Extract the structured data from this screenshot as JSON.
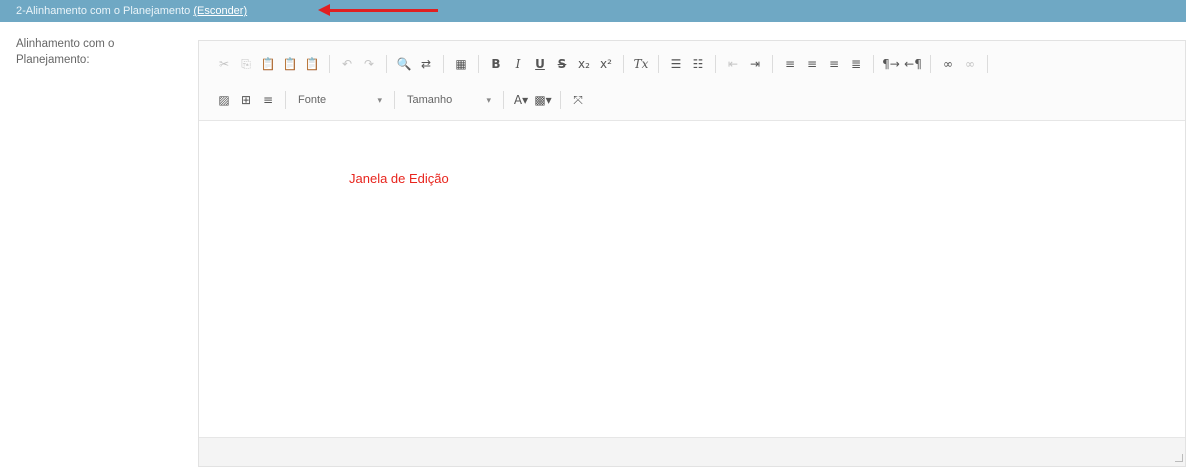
{
  "section": {
    "title": "2-Alinhamento com o Planejamento",
    "hide_link": "(Esconder)"
  },
  "field": {
    "label_line1": "Alinhamento com o",
    "label_line2": "Planejamento:"
  },
  "toolbar": {
    "row1": [
      {
        "name": "cut-icon",
        "glyph": "✂",
        "disabled": true
      },
      {
        "name": "copy-icon",
        "glyph": "⎘",
        "disabled": true
      },
      {
        "name": "paste-icon",
        "glyph": "📋",
        "disabled": false
      },
      {
        "name": "paste-text-icon",
        "glyph": "📋",
        "disabled": false
      },
      {
        "name": "paste-word-icon",
        "glyph": "📋",
        "disabled": false
      },
      {
        "sep": true
      },
      {
        "name": "undo-icon",
        "glyph": "↶",
        "disabled": true
      },
      {
        "name": "redo-icon",
        "glyph": "↷",
        "disabled": true
      },
      {
        "sep": true
      },
      {
        "name": "find-icon",
        "glyph": "🔍",
        "disabled": false
      },
      {
        "name": "replace-icon",
        "glyph": "⇄",
        "disabled": false
      },
      {
        "sep": true
      },
      {
        "name": "select-all-icon",
        "glyph": "▦",
        "disabled": false
      },
      {
        "sep": true
      },
      {
        "name": "bold-icon",
        "glyph": "B",
        "style": "bold"
      },
      {
        "name": "italic-icon",
        "glyph": "I",
        "style": "ital"
      },
      {
        "name": "underline-icon",
        "glyph": "U",
        "style": "und"
      },
      {
        "name": "strikethrough-icon",
        "glyph": "S",
        "style": "strk"
      },
      {
        "name": "subscript-icon",
        "glyph": "x₂"
      },
      {
        "name": "superscript-icon",
        "glyph": "x²"
      },
      {
        "sep": true
      },
      {
        "name": "remove-format-icon",
        "glyph": "Tx",
        "style": "ital"
      },
      {
        "sep": true
      },
      {
        "name": "numbered-list-icon",
        "glyph": "☰"
      },
      {
        "name": "bulleted-list-icon",
        "glyph": "☷"
      },
      {
        "sep": true
      },
      {
        "name": "outdent-icon",
        "glyph": "⇤",
        "disabled": true
      },
      {
        "name": "indent-icon",
        "glyph": "⇥"
      },
      {
        "sep": true
      },
      {
        "name": "align-left-icon",
        "glyph": "≡"
      },
      {
        "name": "align-center-icon",
        "glyph": "≡"
      },
      {
        "name": "align-right-icon",
        "glyph": "≡"
      },
      {
        "name": "align-justify-icon",
        "glyph": "≣"
      },
      {
        "sep": true
      },
      {
        "name": "ltr-icon",
        "glyph": "¶→"
      },
      {
        "name": "rtl-icon",
        "glyph": "←¶"
      },
      {
        "sep": true
      },
      {
        "name": "link-icon",
        "glyph": "∞"
      },
      {
        "name": "unlink-icon",
        "glyph": "∞",
        "disabled": true
      },
      {
        "sep": true
      }
    ],
    "row2_icons_before": [
      {
        "name": "image-icon",
        "glyph": "▨"
      },
      {
        "name": "table-icon",
        "glyph": "⊞"
      },
      {
        "name": "horizontal-line-icon",
        "glyph": "≡"
      }
    ],
    "font_label": "Fonte",
    "size_label": "Tamanho",
    "row2_icons_after": [
      {
        "name": "text-color-icon",
        "glyph": "A▾"
      },
      {
        "name": "background-color-icon",
        "glyph": "▩▾"
      },
      {
        "sep": true
      },
      {
        "name": "maximize-icon",
        "glyph": "⤧"
      }
    ]
  },
  "content": {
    "text": "Janela de Edição"
  }
}
